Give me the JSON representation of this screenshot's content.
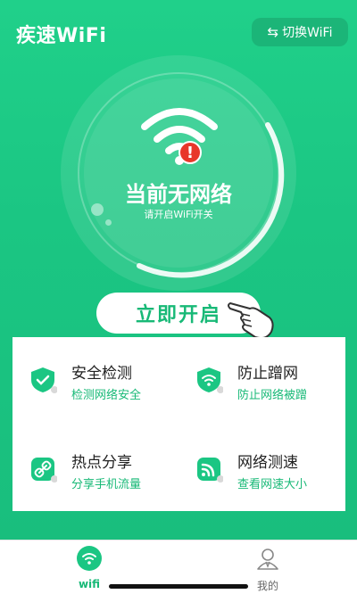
{
  "header": {
    "title": "疾速WiFi",
    "switch_label": "切换WiFi",
    "switch_icon": "swap-icon"
  },
  "status": {
    "title": "当前无网络",
    "subtitle": "请开启WiFi开关"
  },
  "main_button": {
    "label": "立即开启"
  },
  "features": [
    {
      "title": "安全检测",
      "subtitle": "检测网络安全",
      "icon": "shield-check-icon"
    },
    {
      "title": "防止蹭网",
      "subtitle": "防止网络被蹭",
      "icon": "shield-wifi-icon"
    },
    {
      "title": "热点分享",
      "subtitle": "分享手机流量",
      "icon": "link-icon"
    },
    {
      "title": "网络测速",
      "subtitle": "查看网速大小",
      "icon": "signal-icon"
    }
  ],
  "tabbar": {
    "tabs": [
      {
        "label": "wifi",
        "icon": "wifi-icon",
        "active": true
      },
      {
        "label": "我的",
        "icon": "user-icon",
        "active": false
      }
    ]
  },
  "colors": {
    "primary": "#1bc683",
    "accent_text": "#18b977",
    "alert": "#e8372a"
  }
}
